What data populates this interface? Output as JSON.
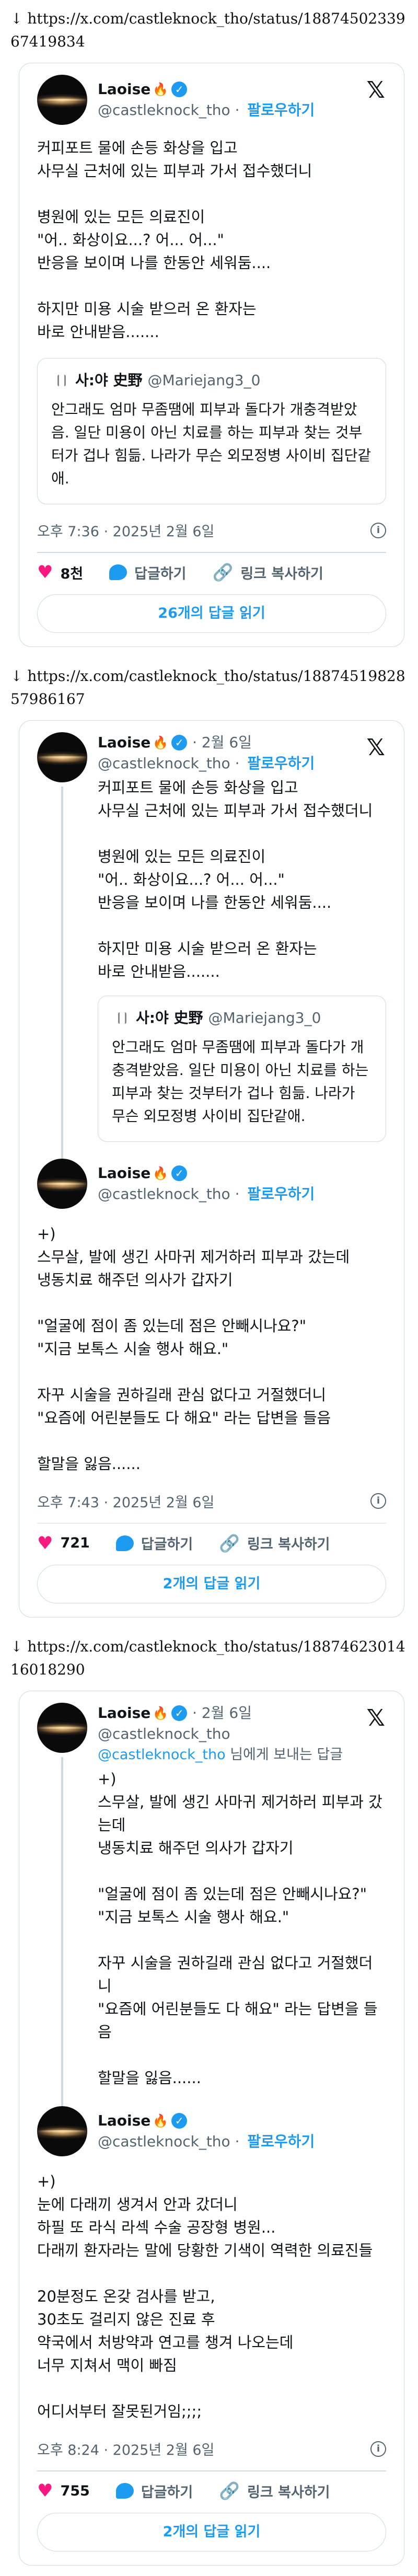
{
  "sections": [
    {
      "url": "↓ https://x.com/castleknock_tho/status/1887450233967419834",
      "tweet": {
        "name": "Laoise",
        "handle": "@castleknock_tho",
        "follow": "팔로우하기",
        "text": "커피포트 물에 손등 화상을 입고\n사무실 근처에 있는 피부과 가서 접수했더니\n\n병원에 있는 모든 의료진이\n\"어.. 화상이요...? 어... 어...\"\n반응을 보이며 나를 한동안 세워둠....\n\n하지만 미용 시술 받으러 온 환자는\n바로 안내받음.......",
        "quote": {
          "name": "사:야 史野",
          "handle": "@Mariejang3_0",
          "text": "안그래도 엄마 무좀땜에 피부과 돌다가 개충격받았음. 일단 미용이 아닌 치료를 하는 피부과 찾는 것부터가 겁나 힘듦. 나라가 무슨 외모정병 사이비 집단같애."
        },
        "time": "오후 7:36 · 2025년 2월 6일",
        "likes": "8천",
        "reply_label": "답글하기",
        "copy_label": "링크 복사하기",
        "read_label": "26개의 답글 읽기"
      }
    },
    {
      "url": "↓ https://x.com/castleknock_tho/status/1887451982857986167",
      "parent": {
        "name": "Laoise",
        "date": "· 2월 6일",
        "handle": "@castleknock_tho",
        "follow": "팔로우하기",
        "text": "커피포트 물에 손등 화상을 입고\n사무실 근처에 있는 피부과 가서 접수했더니\n\n병원에 있는 모든 의료진이\n\"어.. 화상이요...? 어... 어...\"\n반응을 보이며 나를 한동안 세워둠....\n\n하지만 미용 시술 받으러 온 환자는\n바로 안내받음.......",
        "quote": {
          "name": "사:야 史野",
          "handle": "@Mariejang3_0",
          "text": "안그래도 엄마 무좀땜에 피부과 돌다가 개충격받았음. 일단 미용이 아닌 치료를 하는 피부과 찾는 것부터가 겁나 힘듦. 나라가 무슨 외모정병 사이비 집단같애."
        }
      },
      "tweet": {
        "name": "Laoise",
        "handle": "@castleknock_tho",
        "follow": "팔로우하기",
        "text": "+)\n스무살, 발에 생긴 사마귀 제거하러 피부과 갔는데\n냉동치료 해주던 의사가 갑자기\n\n\"얼굴에 점이 좀 있는데 점은 안빼시나요?\"\n\"지금 보톡스 시술 행사 해요.\"\n\n자꾸 시술을 권하길래 관심 없다고 거절했더니\n\"요즘에 어린분들도 다 해요\" 라는 답변을 들음\n\n할말을 잃음......",
        "time": "오후 7:43 · 2025년 2월 6일",
        "likes": "721",
        "reply_label": "답글하기",
        "copy_label": "링크 복사하기",
        "read_label": "2개의 답글 읽기"
      }
    },
    {
      "url": "↓ https://x.com/castleknock_tho/status/1887462301416018290",
      "parent": {
        "name": "Laoise",
        "date": "· 2월 6일",
        "handle": "@castleknock_tho",
        "reply_prefix": "@castleknock_tho",
        "reply_suffix": " 님에게 보내는 답글",
        "text": "+)\n스무살, 발에 생긴 사마귀 제거하러 피부과 갔는데\n냉동치료 해주던 의사가 갑자기\n\n\"얼굴에 점이 좀 있는데 점은 안빼시나요?\"\n\"지금 보톡스 시술 행사 해요.\"\n\n자꾸 시술을 권하길래 관심 없다고 거절했더니\n\"요즘에 어린분들도 다 해요\" 라는 답변을 들음\n\n할말을 잃음......"
      },
      "tweet": {
        "name": "Laoise",
        "handle": "@castleknock_tho",
        "follow": "팔로우하기",
        "text": "+)\n눈에 다래끼 생겨서 안과 갔더니\n하필 또 라식 라섹 수술 공장형 병원...\n다래끼 환자라는 말에 당황한 기색이 역력한 의료진들\n\n20분정도 온갖 검사를 받고,\n30초도 걸리지 않은 진료 후\n약국에서 처방약과 연고를 챙겨 나오는데\n너무 지쳐서 맥이 빠짐\n\n어디서부터 잘못된거임;;;;",
        "time": "오후 8:24 · 2025년 2월 6일",
        "likes": "755",
        "reply_label": "답글하기",
        "copy_label": "링크 복사하기",
        "read_label": "2개의 답글 읽기"
      }
    }
  ],
  "icons": {
    "x_logo": "𝕏",
    "heart": "♥",
    "link": "🔗",
    "info": "i",
    "verified": "✓",
    "flame": "🔥"
  },
  "colors": {
    "accent": "#1d9bf0",
    "like": "#f91880",
    "muted": "#536471",
    "border": "#cfd9de"
  }
}
